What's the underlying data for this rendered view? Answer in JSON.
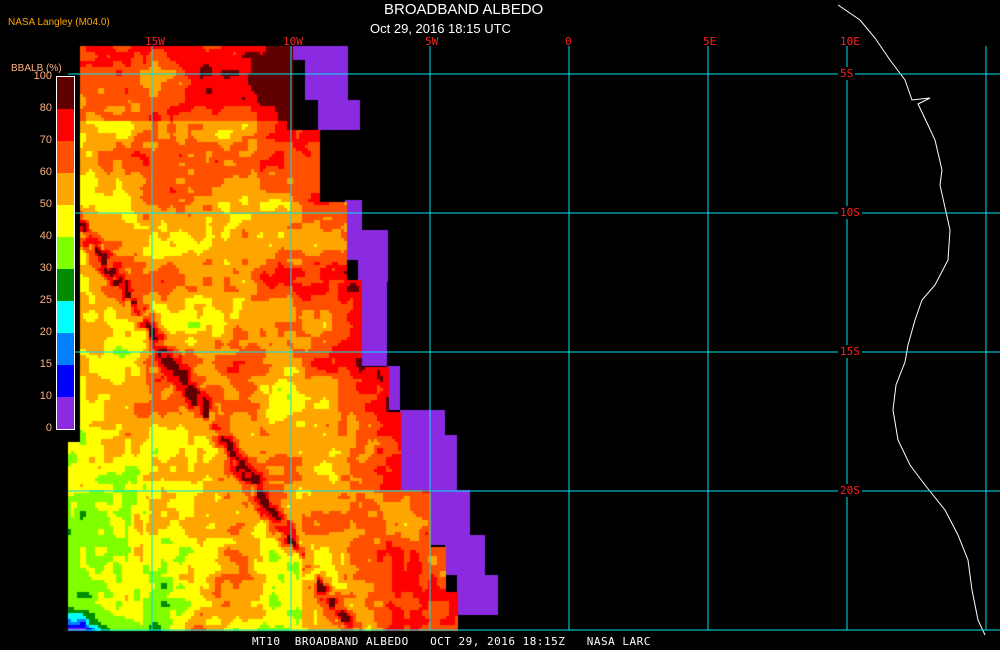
{
  "header": {
    "title": "BROADBAND ALBEDO",
    "subtitle": "Oct 29, 2016 18:15 UTC",
    "credit": "NASA Langley (M04.0)"
  },
  "grid": {
    "longitudes": [
      "15W",
      "10W",
      "5W",
      "0",
      "5E",
      "10E"
    ],
    "latitudes": [
      "5S",
      "10S",
      "15S",
      "20S"
    ],
    "line_color": "#00e5ee",
    "label_color": "#ff2020"
  },
  "legend": {
    "title": "BBALB (%)",
    "ticks": [
      "0",
      "10",
      "15",
      "20",
      "25",
      "30",
      "40",
      "50",
      "60",
      "70",
      "80",
      "100"
    ],
    "colors": [
      "#8a2be2",
      "#0000ff",
      "#0080ff",
      "#00ffff",
      "#008b00",
      "#7fff00",
      "#ffff00",
      "#ffa500",
      "#ff5000",
      "#ff0000",
      "#600000"
    ]
  },
  "footer": {
    "text": "MT10  BROADBAND ALBEDO   OCT 29, 2016 18:15Z   NASA LARC"
  }
}
